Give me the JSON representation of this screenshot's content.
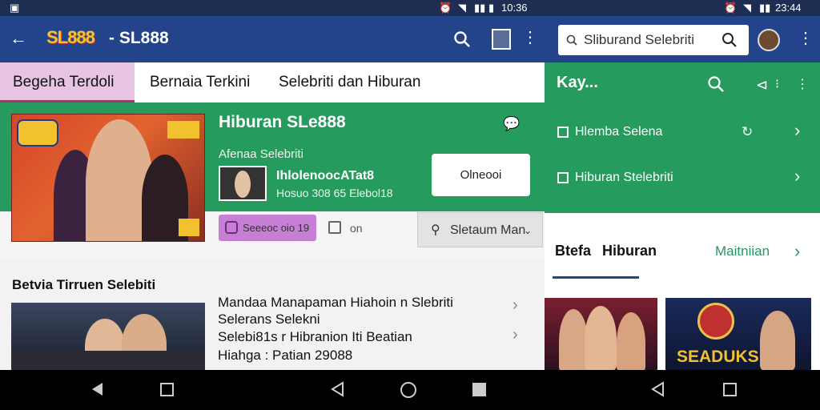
{
  "status_bar": {
    "time_left": "10:36",
    "time_right": "23:44"
  },
  "header": {
    "logo": "SL888",
    "title": "- SL888"
  },
  "tabs": [
    {
      "label": "Begeha Terdoli"
    },
    {
      "label": "Bernaia Terkini"
    },
    {
      "label": "Selebriti dan Hiburan"
    }
  ],
  "feature": {
    "title": "Hiburan SLe888",
    "subtitle": "Afenaa Selebriti",
    "name": "IhlolenoocATat8",
    "meta": "Hosuo 308 65 Elebol18",
    "button_label": "Olneooi",
    "tag_label": "Seeeoc oio 19",
    "count_label": "on",
    "sort_label": "Sletaum Man"
  },
  "news": {
    "section_title": "Betvia Tirruen Selebiti",
    "lines": [
      "Mandaa Manapaman Hiahoin n Slebriti",
      "Selerans Selekni",
      "Selebi81s r Hibranion Iti Beatian",
      "Hiahga : Patian 29088"
    ]
  },
  "right_panel": {
    "search_placeholder": "Sliburand Selebriti",
    "heading": "Kay...",
    "items": [
      {
        "label": "Hlemba Selena"
      },
      {
        "label": "Hiburan Stelebriti"
      }
    ],
    "tab_1": "Btefa",
    "tab_2": "Hiburan",
    "more_label": "Maitniian",
    "card_2_caption": "SEADUKS"
  },
  "colors": {
    "brand_blue": "#23448a",
    "green": "#259b5d",
    "active_tab": "#e6c4e2",
    "purple_tag": "#c77fd6"
  }
}
